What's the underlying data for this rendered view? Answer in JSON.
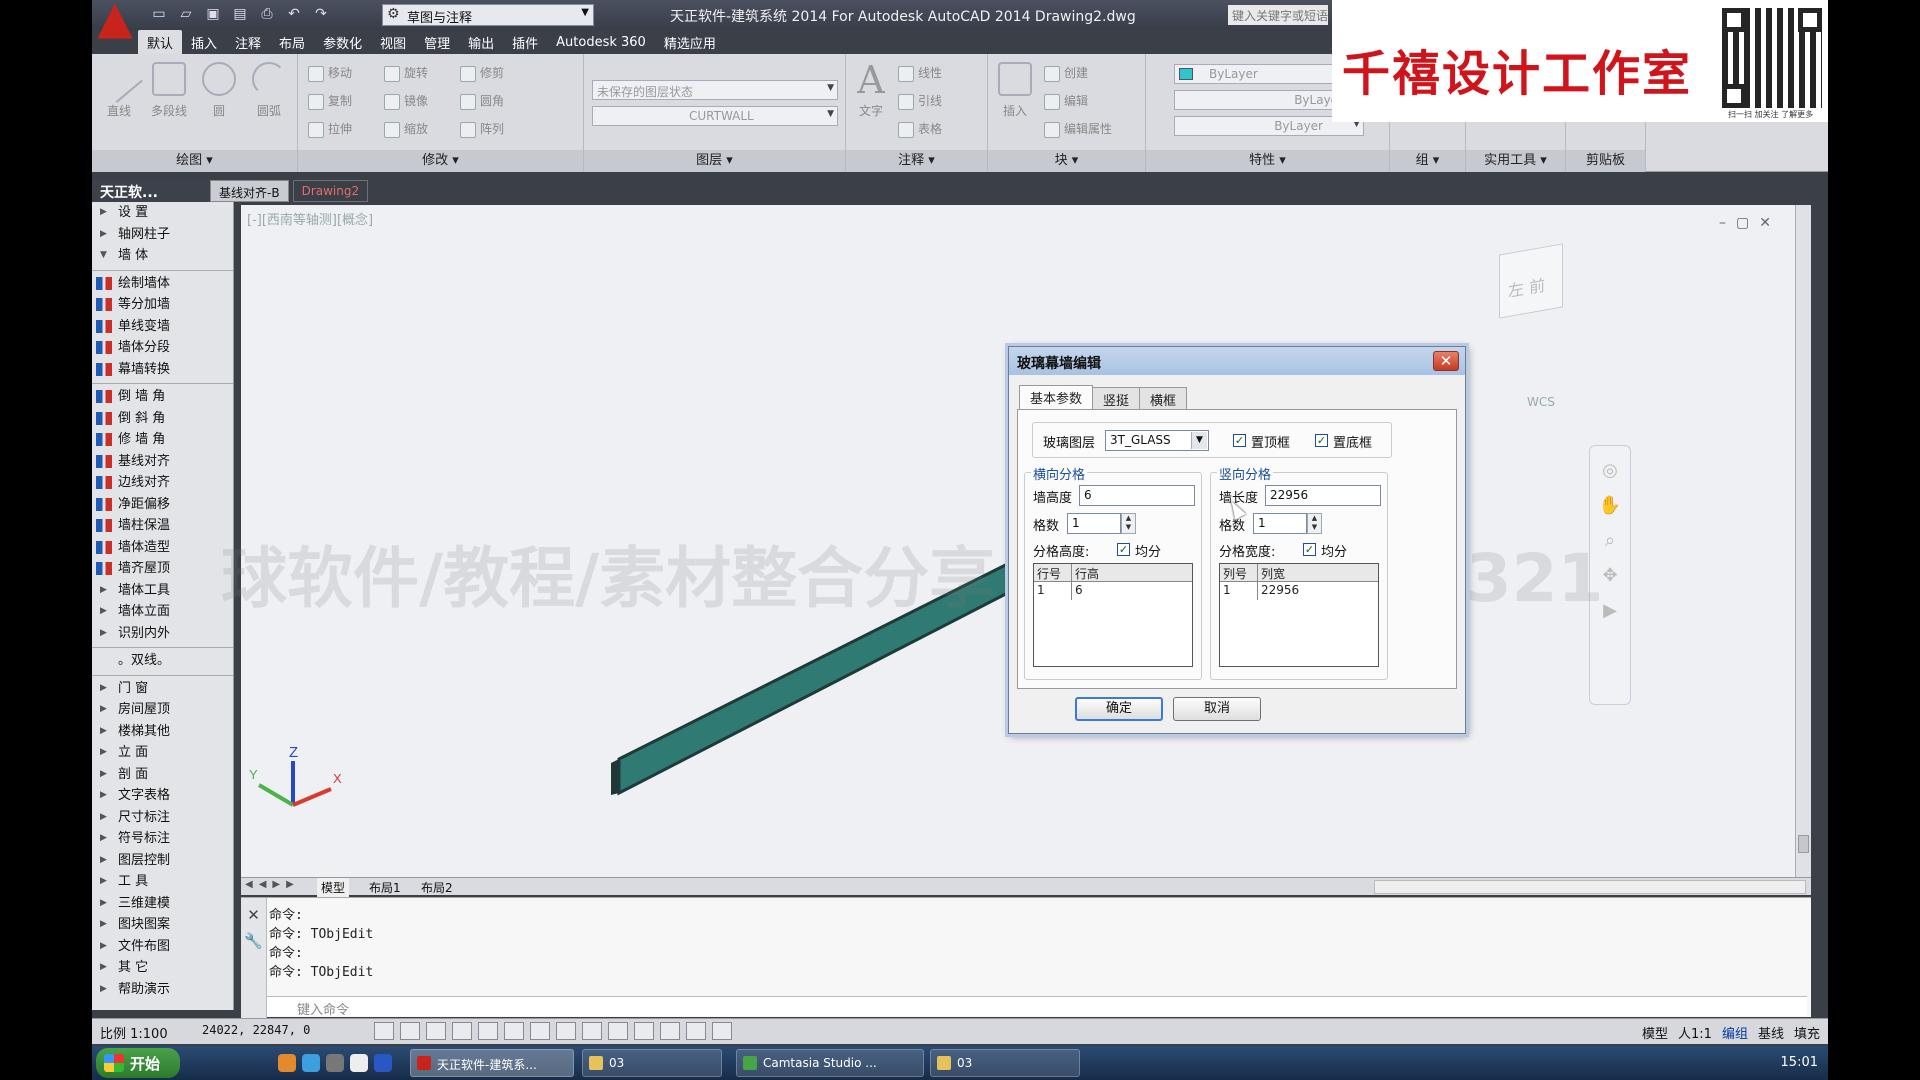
{
  "titlebar": {
    "workspace": "草图与注释",
    "title": "天正软件-建筑系统 2014 For Autodesk AutoCAD 2014   Drawing2.dwg",
    "search_placeholder": "键入关键字或短语"
  },
  "ribbon_tabs": [
    "默认",
    "插入",
    "注释",
    "布局",
    "参数化",
    "视图",
    "管理",
    "输出",
    "插件",
    "Autodesk 360",
    "精选应用"
  ],
  "ribbon": {
    "draw": {
      "label": "绘图",
      "tools": [
        "直线",
        "多段线",
        "圆",
        "圆弧"
      ]
    },
    "modify": {
      "label": "修改",
      "tools": [
        "移动",
        "旋转",
        "修剪",
        "复制",
        "镜像",
        "圆角",
        "拉伸",
        "缩放",
        "阵列"
      ]
    },
    "layer": {
      "label": "图层",
      "state": "未保存的图层状态",
      "current": "CURTWALL"
    },
    "annotate": {
      "label": "注释",
      "tools": [
        "文字",
        "线性",
        "引线",
        "表格"
      ]
    },
    "block": {
      "label": "块",
      "tools": [
        "插入",
        "创建",
        "编辑",
        "编辑属性"
      ]
    },
    "properties": {
      "label": "特性",
      "color": "ByLayer",
      "linetype": "ByLayer",
      "lineweight": "ByLayer"
    },
    "groups": {
      "label": "组"
    },
    "utilities": {
      "label": "实用工具"
    },
    "clipboard": {
      "label": "剪贴板"
    }
  },
  "brand": {
    "name": "千禧设计工作室",
    "qr_caption": "扫一扫 加关注 了解更多"
  },
  "file_tabs": [
    "基线对齐-B",
    "Drawing2"
  ],
  "palette": {
    "title": "天正软...",
    "top_items": [
      {
        "label": "设    置",
        "type": "collapsed"
      },
      {
        "label": "轴网柱子",
        "type": "collapsed"
      },
      {
        "label": "墙    体",
        "type": "expanded"
      }
    ],
    "wall_items": [
      "绘制墙体",
      "等分加墙",
      "单线变墙",
      "墙体分段",
      "幕墙转换"
    ],
    "corner_items": [
      "倒 墙 角",
      "倒 斜 角",
      "修 墙 角",
      "基线对齐",
      "边线对齐",
      "净距偏移",
      "墙柱保温",
      "墙体造型",
      "墙齐屋顶"
    ],
    "sub_items": [
      "墙体工具",
      "墙体立面",
      "识别内外"
    ],
    "double_line": "。双线。",
    "bottom_items": [
      "门    窗",
      "房间屋顶",
      "楼梯其他",
      "立    面",
      "剖    面",
      "文字表格",
      "尺寸标注",
      "符号标注",
      "图层控制",
      "工    具",
      "三维建模",
      "图块图案",
      "文件布图",
      "其    它",
      "帮助演示"
    ]
  },
  "viewport": {
    "label": "[-][西南等轴测][概念]",
    "viewcube_face": "左  前",
    "wcs": "WCS",
    "watermark": "球软件/教程/素材整合分享 微信huahes4321"
  },
  "layout_tabs": [
    "模型",
    "布局1",
    "布局2"
  ],
  "command": {
    "lines": [
      "命令:",
      "命令: TObjEdit",
      "命令:",
      "命令: TObjEdit"
    ],
    "placeholder": "键入命令"
  },
  "status": {
    "scale": "比例 1:100",
    "coords": "24022, 22847, 0",
    "right": [
      "模型",
      "人1:1",
      "编组",
      "基线",
      "填充"
    ]
  },
  "taskbar": {
    "start": "开始",
    "tasks": [
      "天正软件-建筑系...",
      "03",
      "Camtasia Studio ...",
      "03"
    ],
    "clock": "15:01"
  },
  "dialog": {
    "title": "玻璃幕墙编辑",
    "tabs": [
      "基本参数",
      "竖挺",
      "横框"
    ],
    "glass_layer_label": "玻璃图层",
    "glass_layer_value": "3T_GLASS",
    "top_frame_label": "置顶框",
    "top_frame_checked": true,
    "bottom_frame_label": "置底框",
    "bottom_frame_checked": true,
    "horizontal": {
      "title": "横向分格",
      "height_label": "墙高度",
      "height_value": "6",
      "count_label": "格数",
      "count_value": "1",
      "split_label": "分格高度:",
      "even_label": "均分",
      "even_checked": true,
      "col_no": "行号",
      "col_val": "行高",
      "rows": [
        [
          "1",
          "6"
        ]
      ]
    },
    "vertical": {
      "title": "竖向分格",
      "length_label": "墙长度",
      "length_value": "22956",
      "count_label": "格数",
      "count_value": "1",
      "split_label": "分格宽度:",
      "even_label": "均分",
      "even_checked": true,
      "col_no": "列号",
      "col_val": "列宽",
      "rows": [
        [
          "1",
          "22956"
        ]
      ]
    },
    "ok": "确定",
    "cancel": "取消"
  },
  "colors": {
    "wall": "#2f7a72",
    "accent_red": "#d0141c"
  }
}
